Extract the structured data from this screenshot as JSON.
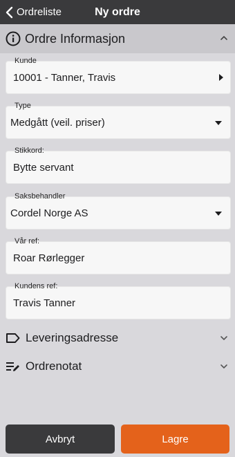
{
  "nav": {
    "back_label": "Ordreliste",
    "title": "Ny ordre"
  },
  "section": {
    "title": "Ordre Informasjon"
  },
  "fields": {
    "kunde": {
      "label": "Kunde",
      "value": "10001 - Tanner, Travis"
    },
    "type": {
      "label": "Type",
      "value": "Medgått (veil. priser)"
    },
    "stikkord": {
      "label": "Stikkord:",
      "value": "Bytte servant"
    },
    "saksbehandler": {
      "label": "Saksbehandler",
      "value": "Cordel Norge AS"
    },
    "var_ref": {
      "label": "Vår ref:",
      "value": "Roar Rørlegger"
    },
    "kundens_ref": {
      "label": "Kundens ref:",
      "value": "Travis Tanner"
    }
  },
  "collapsed": {
    "leveringsadresse": "Leveringsadresse",
    "ordrenotat": "Ordrenotat"
  },
  "actions": {
    "cancel": "Avbryt",
    "save": "Lagre"
  },
  "colors": {
    "topbar": "#3a3a3c",
    "accent": "#e4621b",
    "background": "#d9d8dc"
  }
}
